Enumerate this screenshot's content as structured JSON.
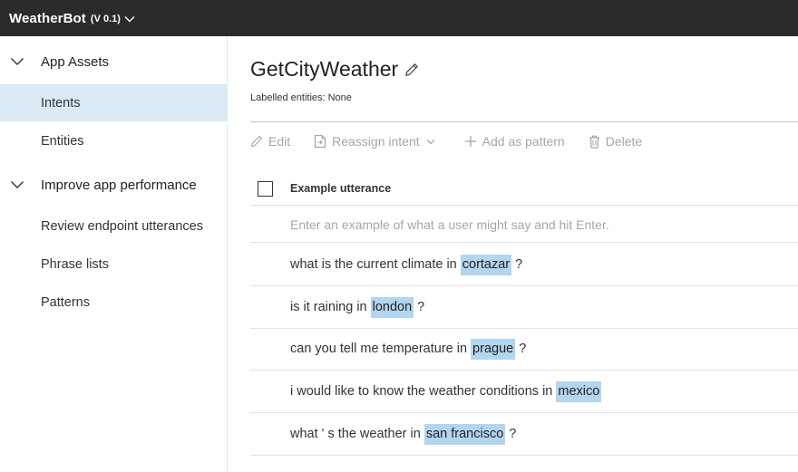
{
  "app": {
    "title": "WeatherBot",
    "version": "(V 0.1)"
  },
  "sidebar": {
    "groups": [
      {
        "label": "App Assets"
      },
      {
        "label": "Improve app performance"
      }
    ],
    "items": [
      {
        "label": "Intents",
        "active": true
      },
      {
        "label": "Entities",
        "active": false
      },
      {
        "label": "Review endpoint utterances",
        "active": false
      },
      {
        "label": "Phrase lists",
        "active": false
      },
      {
        "label": "Patterns",
        "active": false
      }
    ]
  },
  "main": {
    "title": "GetCityWeather",
    "labelled_entities": "Labelled entities: None",
    "toolbar": {
      "edit": "Edit",
      "reassign": "Reassign intent",
      "add_pattern": "Add as pattern",
      "delete": "Delete"
    },
    "column_header": "Example utterance",
    "input_placeholder": "Enter an example of what a user might say and hit Enter.",
    "utterances": [
      {
        "before": "what is the current climate in",
        "entity": "cortazar",
        "after": "?"
      },
      {
        "before": "is it raining in",
        "entity": "london",
        "after": "?"
      },
      {
        "before": "can you tell me temperature in",
        "entity": "prague",
        "after": "?"
      },
      {
        "before": "i would like to know the weather conditions in",
        "entity": "mexico",
        "after": ""
      },
      {
        "before": "what ' s the weather in",
        "entity": "san francisco",
        "after": "?"
      }
    ]
  },
  "colors": {
    "topbar": "#2b2b2b",
    "active_nav": "#dbe9f5",
    "entity_highlight": "#b3d6f0",
    "disabled_text": "#a6a6a6"
  },
  "icons": {
    "app_chevron": "chevron-down-icon",
    "group_chevron": "chevron-down-icon",
    "title_edit": "pencil-icon",
    "edit": "pencil-icon",
    "reassign": "document-icon",
    "add_pattern": "plus-icon",
    "delete": "trash-icon"
  }
}
